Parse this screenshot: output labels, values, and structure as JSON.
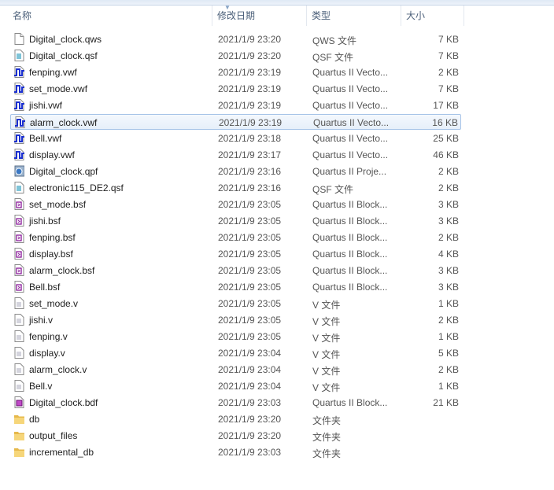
{
  "columns": {
    "name": "名称",
    "date": "修改日期",
    "type": "类型",
    "size": "大小"
  },
  "rows": [
    {
      "name": "Digital_clock.qws",
      "date": "2021/1/9 23:20",
      "type": "QWS 文件",
      "size": "7 KB",
      "icon": "file"
    },
    {
      "name": "Digital_clock.qsf",
      "date": "2021/1/9 23:20",
      "type": "QSF 文件",
      "size": "7 KB",
      "icon": "qsf"
    },
    {
      "name": "fenping.vwf",
      "date": "2021/1/9 23:19",
      "type": "Quartus II Vecto...",
      "size": "2 KB",
      "icon": "vwf"
    },
    {
      "name": "set_mode.vwf",
      "date": "2021/1/9 23:19",
      "type": "Quartus II Vecto...",
      "size": "7 KB",
      "icon": "vwf"
    },
    {
      "name": "jishi.vwf",
      "date": "2021/1/9 23:19",
      "type": "Quartus II Vecto...",
      "size": "17 KB",
      "icon": "vwf"
    },
    {
      "name": "alarm_clock.vwf",
      "date": "2021/1/9 23:19",
      "type": "Quartus II Vecto...",
      "size": "16 KB",
      "icon": "vwf",
      "selected": true
    },
    {
      "name": "Bell.vwf",
      "date": "2021/1/9 23:18",
      "type": "Quartus II Vecto...",
      "size": "25 KB",
      "icon": "vwf"
    },
    {
      "name": "display.vwf",
      "date": "2021/1/9 23:17",
      "type": "Quartus II Vecto...",
      "size": "46 KB",
      "icon": "vwf"
    },
    {
      "name": "Digital_clock.qpf",
      "date": "2021/1/9 23:16",
      "type": "Quartus II Proje...",
      "size": "2 KB",
      "icon": "qpf"
    },
    {
      "name": "electronic115_DE2.qsf",
      "date": "2021/1/9 23:16",
      "type": "QSF 文件",
      "size": "2 KB",
      "icon": "qsf"
    },
    {
      "name": "set_mode.bsf",
      "date": "2021/1/9 23:05",
      "type": "Quartus II Block...",
      "size": "3 KB",
      "icon": "bsf"
    },
    {
      "name": "jishi.bsf",
      "date": "2021/1/9 23:05",
      "type": "Quartus II Block...",
      "size": "3 KB",
      "icon": "bsf"
    },
    {
      "name": "fenping.bsf",
      "date": "2021/1/9 23:05",
      "type": "Quartus II Block...",
      "size": "2 KB",
      "icon": "bsf"
    },
    {
      "name": "display.bsf",
      "date": "2021/1/9 23:05",
      "type": "Quartus II Block...",
      "size": "4 KB",
      "icon": "bsf"
    },
    {
      "name": "alarm_clock.bsf",
      "date": "2021/1/9 23:05",
      "type": "Quartus II Block...",
      "size": "3 KB",
      "icon": "bsf"
    },
    {
      "name": "Bell.bsf",
      "date": "2021/1/9 23:05",
      "type": "Quartus II Block...",
      "size": "3 KB",
      "icon": "bsf"
    },
    {
      "name": "set_mode.v",
      "date": "2021/1/9 23:05",
      "type": "V 文件",
      "size": "1 KB",
      "icon": "v"
    },
    {
      "name": "jishi.v",
      "date": "2021/1/9 23:05",
      "type": "V 文件",
      "size": "2 KB",
      "icon": "v"
    },
    {
      "name": "fenping.v",
      "date": "2021/1/9 23:05",
      "type": "V 文件",
      "size": "1 KB",
      "icon": "v"
    },
    {
      "name": "display.v",
      "date": "2021/1/9 23:04",
      "type": "V 文件",
      "size": "5 KB",
      "icon": "v"
    },
    {
      "name": "alarm_clock.v",
      "date": "2021/1/9 23:04",
      "type": "V 文件",
      "size": "2 KB",
      "icon": "v"
    },
    {
      "name": "Bell.v",
      "date": "2021/1/9 23:04",
      "type": "V 文件",
      "size": "1 KB",
      "icon": "v"
    },
    {
      "name": "Digital_clock.bdf",
      "date": "2021/1/9 23:03",
      "type": "Quartus II Block...",
      "size": "21 KB",
      "icon": "bdf"
    },
    {
      "name": "db",
      "date": "2021/1/9 23:20",
      "type": "文件夹",
      "size": "",
      "icon": "folder"
    },
    {
      "name": "output_files",
      "date": "2021/1/9 23:20",
      "type": "文件夹",
      "size": "",
      "icon": "folder"
    },
    {
      "name": "incremental_db",
      "date": "2021/1/9 23:03",
      "type": "文件夹",
      "size": "",
      "icon": "folder"
    }
  ]
}
